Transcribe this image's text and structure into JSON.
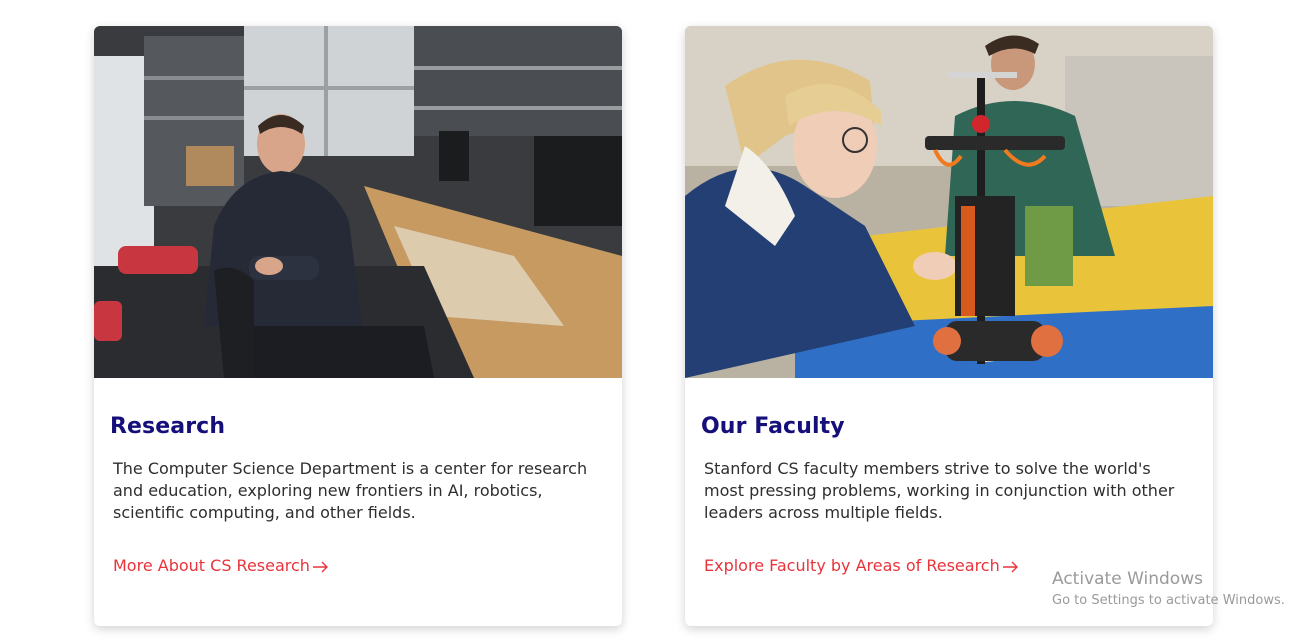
{
  "cards": [
    {
      "title": "Research",
      "text": "The Computer Science Department is a center for research and education, exploring new frontiers in AI, robotics, scientific computing, and other fields.",
      "link_label": "More About CS Research",
      "image_icon": "photo-lab-researcher"
    },
    {
      "title": "Our Faculty",
      "text": "Stanford CS faculty members strive to solve the world's most pressing problems, working in conjunction with other leaders across multiple fields.",
      "link_label": "Explore Faculty by Areas of Research",
      "image_icon": "photo-robot-building"
    }
  ],
  "colors": {
    "title": "#150f7a",
    "link": "#e8343b",
    "body_text": "#2e2e2e"
  },
  "watermark": {
    "title": "Activate Windows",
    "subtitle": "Go to Settings to activate Windows."
  }
}
